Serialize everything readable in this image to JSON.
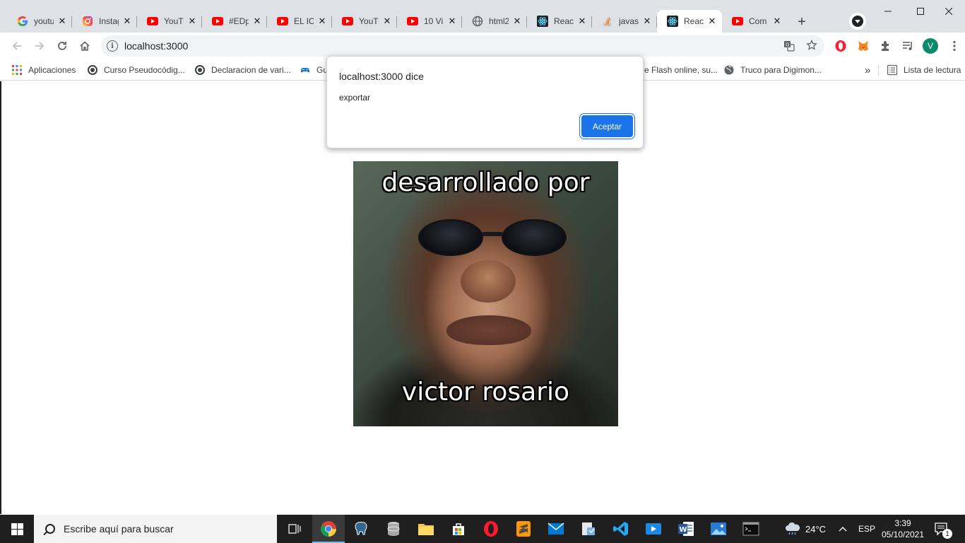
{
  "tabs": [
    {
      "title": "youtu",
      "icon": "google-icon",
      "active": false
    },
    {
      "title": "Instag",
      "icon": "instagram-icon",
      "active": false
    },
    {
      "title": "YouTu",
      "icon": "youtube-icon",
      "active": false
    },
    {
      "title": "#EDp",
      "icon": "youtube-icon",
      "active": false
    },
    {
      "title": "EL ICI",
      "icon": "youtube-icon",
      "active": false
    },
    {
      "title": "YouTu",
      "icon": "youtube-icon",
      "active": false
    },
    {
      "title": "10 Vi",
      "icon": "youtube-icon",
      "active": false
    },
    {
      "title": "html2",
      "icon": "globe-icon",
      "active": false
    },
    {
      "title": "React",
      "icon": "react-icon",
      "active": false
    },
    {
      "title": "javas",
      "icon": "stackoverflow-icon",
      "active": false
    },
    {
      "title": "React",
      "icon": "react-icon",
      "active": true
    },
    {
      "title": "Com",
      "icon": "youtube-icon",
      "active": false
    }
  ],
  "toolbar": {
    "url": "localhost:3000",
    "profile_initial": "V"
  },
  "bookmarks": {
    "apps_label": "Aplicaciones",
    "items": [
      {
        "label": "Curso Pseudocódig...",
        "icon": "site-icon"
      },
      {
        "label": "Declaracion de vari...",
        "icon": "site-icon"
      },
      {
        "label": "Gu",
        "icon": "gamepad-icon"
      },
      {
        "label": "e Flash online, su...",
        "icon": "site-icon"
      },
      {
        "label": "Truco para Digimon...",
        "icon": "globe-icon"
      }
    ],
    "more": "»",
    "reading_list": "Lista de lectura"
  },
  "dialog": {
    "title": "localhost:3000 dice",
    "message": "exportar",
    "ok_label": "Aceptar"
  },
  "meme": {
    "top_text": "desarrollado por",
    "bottom_text": "victor rosario"
  },
  "taskbar": {
    "search_placeholder": "Escribe aquí para buscar",
    "weather": "24°C",
    "language": "ESP",
    "time": "3:39",
    "date": "05/10/2021",
    "notification_count": "1"
  },
  "colors": {
    "accent": "#1a73e8",
    "tabstrip": "#dee1e6",
    "taskbar": "#1f1f1f"
  }
}
